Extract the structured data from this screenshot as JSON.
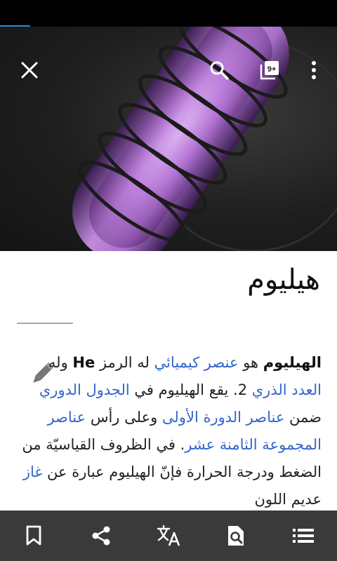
{
  "page": {
    "progress_percent": 9
  },
  "toolbar": {
    "tabs_badge": "9+",
    "icons": [
      "close-icon",
      "search-icon",
      "tabs-icon",
      "overflow-menu-icon"
    ]
  },
  "article": {
    "title": "هيليوم",
    "paragraph": {
      "bold_subject": "الهيليوم",
      "t1": " هو ",
      "link_element": "عنصر كيميائي",
      "t2": " له الرمز ",
      "symbol": "He",
      "t3": " وله ",
      "link_atomic_number": "العدد الذري",
      "t4": " 2. يقع الهيليوم في ",
      "link_periodic_table": "الجدول الدوري",
      "t5": " ضمن ",
      "link_period1": "عناصر الدورة الأولى",
      "t6": " وعلى رأس ",
      "link_group18": "عناصر المجموعة الثامنة عشر",
      "t7": ". في الظروف القياسيّة من الضغط ودرجة الحرارة فإنّ الهيليوم عبارة عن ",
      "link_gas": "غاز",
      "t8": " عديم اللون"
    }
  },
  "bottom_bar": {
    "icons": [
      "bookmark-icon",
      "share-icon",
      "translate-icon",
      "find-in-page-icon",
      "contents-icon"
    ]
  },
  "colors": {
    "link": "#3366cc",
    "bottom_bar": "#3a3a3a",
    "progress": "#2a8bd6"
  }
}
